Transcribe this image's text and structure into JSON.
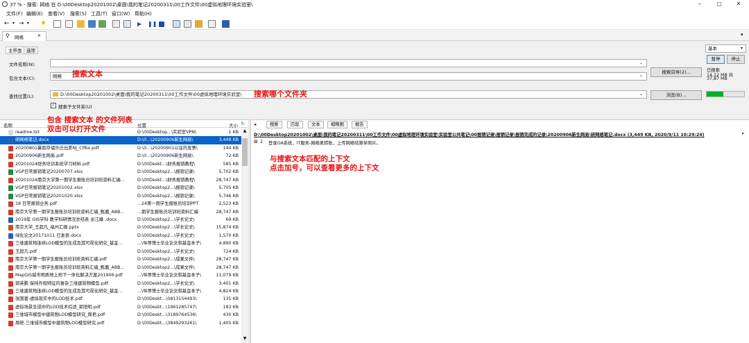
{
  "window": {
    "title": "37 % - 搜索: 网络 在 D:\\00Desktop20201002\\桌面\\我的笔记20200311\\00工作文件\\00虚拟地理环境实验室\\",
    "minimize": "–",
    "maximize": "▢",
    "close": "✕"
  },
  "menu": [
    "文件(F)",
    "编辑(E)",
    "查看(V)",
    "搜索(S)",
    "工具(T)",
    "窗口(W)",
    "帮助(H)"
  ],
  "doc_tab": {
    "label": "网络",
    "close": "✕"
  },
  "panel": {
    "tabs": [
      "主界面",
      "选项"
    ],
    "filename_label": "文件名称(N):",
    "filename_value": "",
    "content_label": "包含文本(C):",
    "content_value": "网络",
    "location_label": "查找位置(L):",
    "location_value": "D:\\00Desktop20201002\\桌面\\我的笔记20200311\\00工作文件\\00虚拟地理环境实验室\\",
    "subfolder_label": "搜索子文件夹(U)",
    "wizard_button": "搜索向导(2)...",
    "browse_button": "浏览(B)...",
    "mode_select": "基本",
    "pause_button": "暂停",
    "stop_button": "停止",
    "status_1": "已搜索",
    "status_2": "14,12 MB 共",
    "status_3": "37,87 MB",
    "progress": 0.45
  },
  "annotations": {
    "search_text": "搜索文本",
    "search_folder": "搜索哪个文件夹",
    "file_list_1": "包含 搜索文本 的文件列表",
    "file_list_2": "双击可以打开文件",
    "context_1": "与搜索文本匹配的上下文",
    "context_2": "点击加号，可以查看更多的上下文"
  },
  "list": {
    "headers": {
      "name": "名称",
      "path": "位置",
      "size": "大小"
    },
    "rows": [
      {
        "name": "readme.txt",
        "path": "D:\\00Desktop...\\实验室VPN\\",
        "size": "1 KB",
        "icon": "#d8d8d8"
      },
      {
        "name": "研网络笔记.docx",
        "path": "D:\\0...\\20200906新生网易\\",
        "size": "3,449 KB",
        "icon": "#2b5fb0"
      },
      {
        "name": "20200801暑假存储外迁出差NJ_Clfbx.pdf",
        "path": "D:\\0...\\20200901以往的发票\\",
        "size": "144 KB",
        "icon": "#d63a2e"
      },
      {
        "name": "20200906新生网易.pdf",
        "path": "D:\\0...\\20200906新生网易\\",
        "size": "72 KB",
        "icon": "#d63a2e"
      },
      {
        "name": "20201024财务培训系统学习材料.pdf",
        "path": "D:\\00Deskt...\\财务报销教程\\",
        "size": "585 KB",
        "icon": "#d63a2e"
      },
      {
        "name": "VGP日常报销笔记20200707.xlsx",
        "path": "D:\\00Desktop2...\\报销记录\\",
        "size": "5,702 KB",
        "icon": "#1f8a45"
      },
      {
        "name": "20201024南京大学第一期学生报账员培训班资料汇编...",
        "path": "D:\\00Deskt...\\财务报销教程\\",
        "size": "28,747 KB",
        "icon": "#d63a2e"
      },
      {
        "name": "VGP日常报销笔记20201002.xlsx",
        "path": "D:\\00Desktop2...\\报销记录\\",
        "size": "5,705 KB",
        "icon": "#1f8a45"
      },
      {
        "name": "VGP日常报销笔记20201020.xlsx",
        "path": "D:\\00Desktop2...\\报销记录\\",
        "size": "5,746 KB",
        "icon": "#1f8a45"
      },
      {
        "name": "18 日常报销业务.pdf",
        "path": "...24第一期学生报账员培训PPT",
        "size": "2,523 KB",
        "icon": "#d63a2e"
      },
      {
        "name": "南京大学第一期学生报账员培训班资料汇编_甄嘉_ABB...",
        "path": "...期学生报账员培训班资料汇编",
        "size": "28,747 KB",
        "icon": "#d63a2e"
      },
      {
        "name": "2019年 GIS学科 教学科研情况总结表 余江峰 .docx",
        "path": "D:\\00Desktop2...\\学长论文\\",
        "size": "69 KB",
        "icon": "#2b5fb0"
      },
      {
        "name": "南京大学_王超凡_福州汇报.pptx",
        "path": "D:\\00Desktop2...\\学长论文\\",
        "size": "15,874 KB",
        "icon": "#c9501c"
      },
      {
        "name": "绿化论文20171011 已发表.docx",
        "path": "D:\\00Desktop2...\\学长论文\\",
        "size": "1,570 KB",
        "icon": "#2b5fb0"
      },
      {
        "name": "三维建筑物连续LOD模型的生成及其可视化研究_基金...",
        "path": "...\\导师博士毕业论文和基金本子\\",
        "size": "4,890 KB",
        "icon": "#d63a2e"
      },
      {
        "name": "王超凡.pdf",
        "path": "D:\\00Desktop2...\\学长论文\\",
        "size": "724 KB",
        "icon": "#d63a2e"
      },
      {
        "name": "南京大学第一期学生报账员培训班资料汇编.pdf",
        "path": "D:\\00Desktop2...\\成果文件\\",
        "size": "28,747 KB",
        "icon": "#d63a2e"
      },
      {
        "name": "南京大学第一期学生报账员培训班资料汇编_甄嘉_ABB...",
        "path": "D:\\00Desktop2...\\成果文件\\",
        "size": "28,747 KB",
        "icon": "#d63a2e"
      },
      {
        "name": "MapGIS城市地质地上地下一体化解决方案201906.pdf",
        "path": "...\\导师博士毕业论文和基金本子\\",
        "size": "11,079 KB",
        "icon": "#d63a2e"
      },
      {
        "name": "郭英鹏 保持外观特征的复杂三维建筑物模型.pdf",
        "path": "D:\\00Desktop2...\\学长论文\\",
        "size": "3,401 KB",
        "icon": "#d63a2e"
      },
      {
        "name": "三维建筑物连续LOD模型的生成及其可视化研究_基金...",
        "path": "...\\导师博士毕业论文和基金本子\\",
        "size": "4,824 KB",
        "icon": "#d63a2e"
      },
      {
        "name": "张国富-虚拟现实中的LOD技术.pdf",
        "path": "D:\\00Deskt...\\0813154493\\",
        "size": "135 KB",
        "icon": "#d63a2e"
      },
      {
        "name": "虚拟场景生成中的LOD技术综述_郭阳明.pdf",
        "path": "D:\\00Deskt...\\1961285747\\",
        "size": "183 KB",
        "icon": "#d63a2e"
      },
      {
        "name": "三维城市模型中建筑物LOD模型研究_周艳.pdf",
        "path": "D:\\00Deskt...\\3189764536\\",
        "size": "430 KB",
        "icon": "#d63a2e"
      },
      {
        "name": "周艳-三维城市模型中建筑物LOD模型研究.pdf",
        "path": "D:\\00Deskt...\\3849293261\\",
        "size": "1,405 KB",
        "icon": "#d63a2e"
      }
    ]
  },
  "preview": {
    "tabs": [
      "搜索",
      "匹配",
      "文本",
      "缩略图",
      "报告"
    ],
    "file_header": "D:\\00Desktop20201002\\桌面\\我的笔记20200311\\00工作文件\\00虚拟地理环境实验室\\实验室公共笔记\\00报销记录\\报销记录\\报销完成的记录\\20200906新生网易\\研网络笔记.docx  (3,449 KB, 2020/9/11 10:29:24)",
    "context_line_no": "2",
    "context_text": "登录OA系统，IT服务-网络离转账，上传网络结算单照片。"
  }
}
